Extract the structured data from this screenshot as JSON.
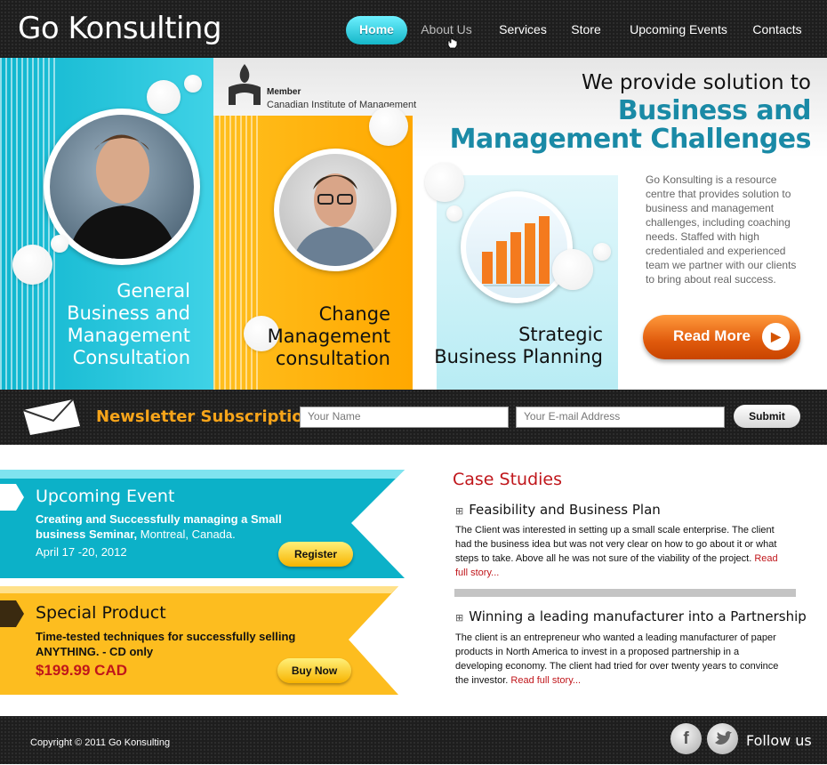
{
  "header": {
    "logo": "Go Konsulting",
    "nav": [
      {
        "label": "Home"
      },
      {
        "label": "About Us"
      },
      {
        "label": "Services"
      },
      {
        "label": "Store"
      },
      {
        "label": "Upcoming Events"
      },
      {
        "label": "Contacts"
      }
    ]
  },
  "hero": {
    "panels": [
      {
        "title": "General\nBusiness and\nManagement\nConsultation"
      },
      {
        "title": "Change\nManagement\nconsultation"
      },
      {
        "title": "Strategic\nBusiness Planning"
      }
    ],
    "member_label": "Member",
    "member_org": "Canadian Institute of Management",
    "tagline_line1": "We provide solution to",
    "tagline_line2": "Business and",
    "tagline_line3": "Management Challenges",
    "description": "Go Konsulting is a resource centre that provides solution to business and management challenges, including coaching needs. Staffed with high credentialed and experienced team we partner with our clients to bring about real success.",
    "read_more": "Read More"
  },
  "newsletter": {
    "title": "Newsletter Subscription",
    "name_placeholder": "Your Name",
    "email_placeholder": "Your E-mail Address",
    "submit": "Submit"
  },
  "event": {
    "title": "Upcoming Event",
    "name": "Creating and Successfully managing a Small business Seminar,",
    "location": "Montreal, Canada.",
    "date": "April 17 -20, 2012",
    "button": "Register"
  },
  "product": {
    "title": "Special Product",
    "text": "Time-tested techniques for successfully selling ANYTHING. - CD only",
    "price": "$199.99 CAD",
    "button": "Buy Now"
  },
  "case_studies": {
    "heading": "Case Studies",
    "items": [
      {
        "title": "Feasibility and Business Plan",
        "text": "The Client was interested in setting up a small scale enterprise. The client had the business idea but was not very clear on how to go about it or what steps to take. Above all he was not sure of the viability of the project.",
        "link": "Read full story..."
      },
      {
        "title": "Winning a leading manufacturer into a Partnership",
        "text": "The client is an entrepreneur who wanted a leading manufacturer of paper products in North America to invest in a proposed partnership in a developing economy. The client had tried for over twenty years to convince the investor.",
        "link": "Read full story..."
      }
    ]
  },
  "footer": {
    "copyright": "Copyright © 2011 Go Konsulting",
    "follow": "Follow us",
    "social_icons": [
      "facebook-icon",
      "twitter-icon"
    ]
  },
  "colors": {
    "accent_cyan": "#14b6c8",
    "accent_orange": "#f6a41a",
    "heading_red": "#c0161b",
    "tagline_blue": "#1a8aa6"
  }
}
